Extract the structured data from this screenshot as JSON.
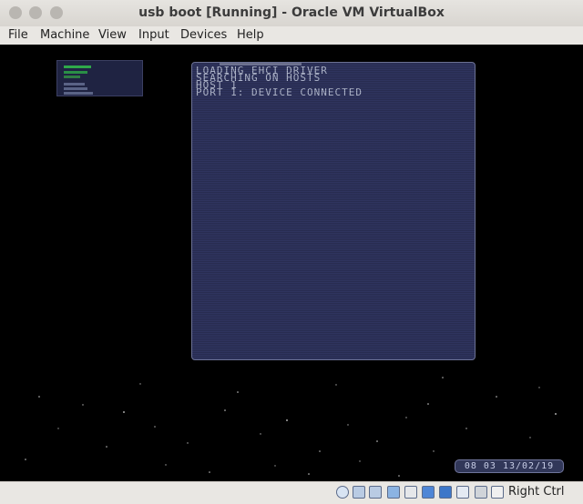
{
  "window": {
    "title": "usb boot [Running] - Oracle VM VirtualBox"
  },
  "menu": [
    "File",
    "Machine",
    "View",
    "Input",
    "Devices",
    "Help"
  ],
  "console": {
    "lines": [
      "LOADING EHCI DRIVER",
      "SEARCHING ON HOSTS",
      "HOST 1",
      "PORT 1: DEVICE CONNECTED"
    ]
  },
  "clock": "08 03 13/02/19",
  "status": {
    "host_key": "Right Ctrl"
  }
}
